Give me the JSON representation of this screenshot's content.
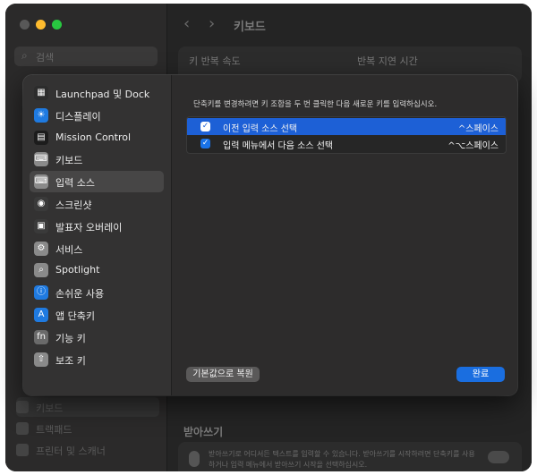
{
  "window": {
    "title": "키보드",
    "search_placeholder": "검색",
    "bg_sidebar_items": [
      "",
      "",
      "",
      "",
      "",
      "",
      "",
      "",
      "",
      "",
      "",
      "",
      "",
      "",
      "",
      "",
      "",
      "",
      "키보드",
      "트랙패드",
      "프린터 및 스캐너"
    ],
    "bg_fields": {
      "key_repeat": "키 반복 속도",
      "repeat_delay": "반복 지연 시간"
    },
    "dictation": {
      "section": "받아쓰기",
      "description": "받아쓰기로 어디서든 텍스트를 입력할 수 있습니다. 받아쓰기를 시작하려면 단축키를 사용하거나 입력 메뉴에서 받아쓰기 시작을 선택하십시오."
    }
  },
  "sheet": {
    "categories": [
      {
        "label": "Launchpad 및 Dock",
        "icon": "launchpad-icon",
        "color": "#2c2c2c"
      },
      {
        "label": "디스플레이",
        "icon": "display-icon",
        "color": "#1f7ae0"
      },
      {
        "label": "Mission Control",
        "icon": "mission-control-icon",
        "color": "#1c1c1c"
      },
      {
        "label": "키보드",
        "icon": "keyboard-icon",
        "color": "#8a8a8a"
      },
      {
        "label": "입력 소스",
        "icon": "input-sources-icon",
        "color": "#8a8a8a"
      },
      {
        "label": "스크린샷",
        "icon": "screenshot-icon",
        "color": "#3a3a3a"
      },
      {
        "label": "발표자 오버레이",
        "icon": "presenter-overlay-icon",
        "color": "#3a3a3a"
      },
      {
        "label": "서비스",
        "icon": "services-icon",
        "color": "#8a8a8a"
      },
      {
        "label": "Spotlight",
        "icon": "spotlight-icon",
        "color": "#8a8a8a"
      },
      {
        "label": "손쉬운 사용",
        "icon": "accessibility-icon",
        "color": "#1f7ae0"
      },
      {
        "label": "앱 단축키",
        "icon": "app-shortcuts-icon",
        "color": "#1f7ae0"
      },
      {
        "label": "기능 키",
        "icon": "function-keys-icon",
        "color": "#6a6a6a"
      },
      {
        "label": "보조 키",
        "icon": "modifier-keys-icon",
        "color": "#8a8a8a"
      }
    ],
    "active_category": "입력 소스",
    "hint": "단축키를 변경하려면 키 조합을 두 번 클릭한 다음 새로운 키를 입력하십시오.",
    "shortcuts": [
      {
        "name": "이전 입력 소스 선택",
        "key": "^스페이스",
        "checked": true,
        "selected": true
      },
      {
        "name": "입력 메뉴에서 다음 소스 선택",
        "key": "^⌥스페이스",
        "checked": true,
        "selected": false
      }
    ],
    "restore_label": "기본값으로 복원",
    "done_label": "완료"
  },
  "colors": {
    "accent": "#1a6ee0",
    "selection": "#1d60d6"
  }
}
